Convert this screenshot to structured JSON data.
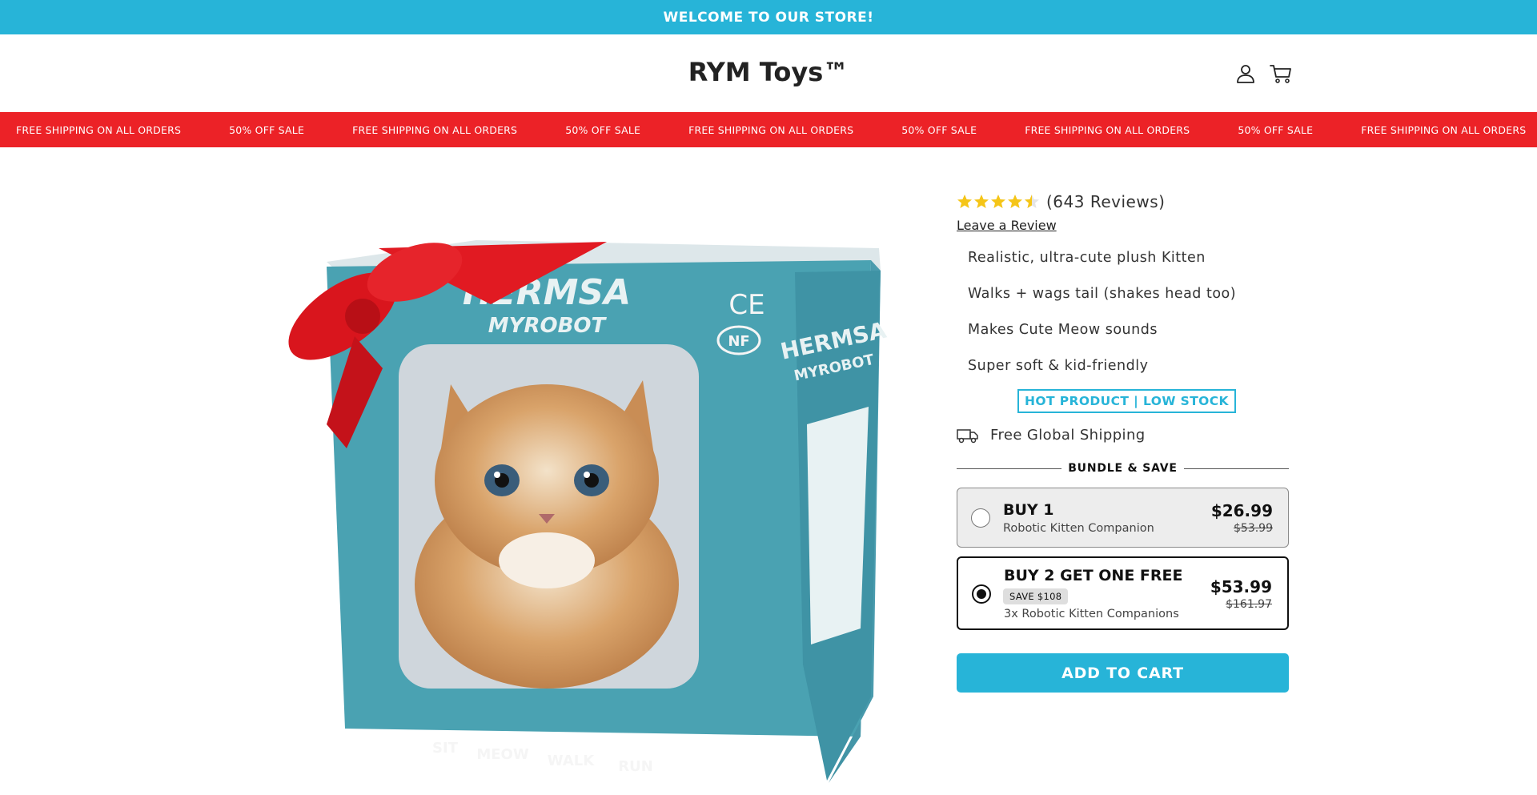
{
  "announcement": {
    "text": "WELCOME TO OUR STORE!"
  },
  "header": {
    "logo": "RYM Toys™",
    "icons": [
      "account-icon",
      "cart-icon"
    ]
  },
  "marquee": {
    "items": [
      "FREE SHIPPING ON ALL ORDERS",
      "50% OFF SALE",
      "FREE SHIPPING ON ALL ORDERS",
      "50% OFF SALE",
      "FREE SHIPPING ON ALL ORDERS",
      "50% OFF SALE",
      "FREE SHIPPING ON ALL ORDERS",
      "50% OFF SALE",
      "FREE SHIPPING ON ALL ORDERS"
    ]
  },
  "product_image": {
    "box_brand": "HERMSA",
    "box_subbrand": "MYROBOT",
    "box_marks": [
      "CE",
      "NF"
    ],
    "actions": [
      "SIT",
      "MEOW",
      "WALK",
      "RUN"
    ]
  },
  "product": {
    "rating": 4.5,
    "review_count_text": "(643 Reviews)",
    "leave_review": "Leave a Review",
    "features": [
      "Realistic, ultra-cute plush Kitten",
      "Walks + wags tail (shakes head too)",
      "Makes Cute Meow sounds",
      "Super soft & kid-friendly"
    ],
    "badge": "HOT PRODUCT | LOW STOCK",
    "shipping": "Free Global Shipping",
    "bundle_heading": "BUNDLE & SAVE",
    "options": [
      {
        "title": "BUY 1",
        "subtitle": "Robotic Kitten Companion",
        "price": "$26.99",
        "compare_price": "$53.99",
        "selected": false
      },
      {
        "title": "BUY 2 GET ONE FREE",
        "badge": "SAVE $108",
        "subtitle": "3x Robotic Kitten Companions",
        "price": "$53.99",
        "compare_price": "$161.97",
        "selected": true
      }
    ],
    "add_to_cart": "ADD TO CART"
  },
  "colors": {
    "accent": "#27b4d8",
    "sale_red": "#ec2227",
    "star": "#f5c518",
    "ribbon": "#e11a22",
    "box": "#4aa2b2"
  }
}
